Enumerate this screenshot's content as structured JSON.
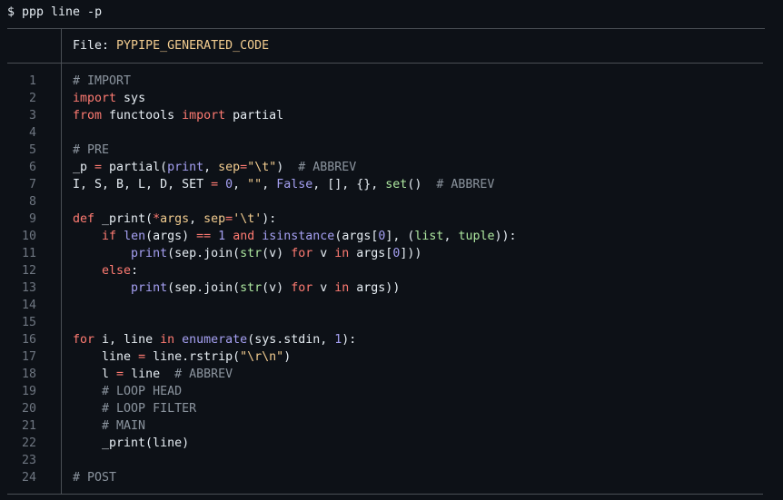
{
  "terminal": {
    "prompt": "$ ppp line -p",
    "header_label": "File: ",
    "header_filename": "PYPIPE_GENERATED_CODE"
  },
  "line_numbers": [
    "1",
    "2",
    "3",
    "4",
    "5",
    "6",
    "7",
    "8",
    "9",
    "10",
    "11",
    "12",
    "13",
    "14",
    "15",
    "16",
    "17",
    "18",
    "19",
    "20",
    "21",
    "22",
    "23",
    "24"
  ],
  "code_lines": [
    [
      {
        "t": "# IMPORT",
        "c": "cm"
      }
    ],
    [
      {
        "t": "import",
        "c": "kw"
      },
      {
        "t": " sys",
        "c": "plain"
      }
    ],
    [
      {
        "t": "from",
        "c": "kw"
      },
      {
        "t": " functools ",
        "c": "plain"
      },
      {
        "t": "import",
        "c": "kw"
      },
      {
        "t": " partial",
        "c": "plain"
      }
    ],
    [],
    [
      {
        "t": "# PRE",
        "c": "cm"
      }
    ],
    [
      {
        "t": "_p",
        "c": "plain"
      },
      {
        "t": " = ",
        "c": "op"
      },
      {
        "t": "partial(",
        "c": "plain"
      },
      {
        "t": "print",
        "c": "bi"
      },
      {
        "t": ", ",
        "c": "plain"
      },
      {
        "t": "sep",
        "c": "str"
      },
      {
        "t": "=",
        "c": "op"
      },
      {
        "t": "\"\\t\"",
        "c": "str"
      },
      {
        "t": ")  ",
        "c": "plain"
      },
      {
        "t": "# ABBREV",
        "c": "cm"
      }
    ],
    [
      {
        "t": "I, S, B, L, D, SET ",
        "c": "plain"
      },
      {
        "t": "=",
        "c": "op"
      },
      {
        "t": " ",
        "c": "plain"
      },
      {
        "t": "0",
        "c": "num"
      },
      {
        "t": ", ",
        "c": "plain"
      },
      {
        "t": "\"\"",
        "c": "str"
      },
      {
        "t": ", ",
        "c": "plain"
      },
      {
        "t": "False",
        "c": "bi"
      },
      {
        "t": ", [], {}, ",
        "c": "plain"
      },
      {
        "t": "set",
        "c": "green"
      },
      {
        "t": "()  ",
        "c": "plain"
      },
      {
        "t": "# ABBREV",
        "c": "cm"
      }
    ],
    [],
    [
      {
        "t": "def",
        "c": "kw"
      },
      {
        "t": " _print(",
        "c": "plain"
      },
      {
        "t": "*",
        "c": "op"
      },
      {
        "t": "args",
        "c": "str"
      },
      {
        "t": ", ",
        "c": "plain"
      },
      {
        "t": "sep",
        "c": "str"
      },
      {
        "t": "=",
        "c": "op"
      },
      {
        "t": "'\\t'",
        "c": "str"
      },
      {
        "t": "):",
        "c": "plain"
      }
    ],
    [
      {
        "t": "    ",
        "c": "plain"
      },
      {
        "t": "if",
        "c": "kw"
      },
      {
        "t": " ",
        "c": "plain"
      },
      {
        "t": "len",
        "c": "bi"
      },
      {
        "t": "(args) ",
        "c": "plain"
      },
      {
        "t": "==",
        "c": "op"
      },
      {
        "t": " ",
        "c": "plain"
      },
      {
        "t": "1",
        "c": "num"
      },
      {
        "t": " ",
        "c": "plain"
      },
      {
        "t": "and",
        "c": "kw"
      },
      {
        "t": " ",
        "c": "plain"
      },
      {
        "t": "isinstance",
        "c": "bi"
      },
      {
        "t": "(args[",
        "c": "plain"
      },
      {
        "t": "0",
        "c": "num"
      },
      {
        "t": "], (",
        "c": "plain"
      },
      {
        "t": "list",
        "c": "green"
      },
      {
        "t": ", ",
        "c": "plain"
      },
      {
        "t": "tuple",
        "c": "green"
      },
      {
        "t": ")):",
        "c": "plain"
      }
    ],
    [
      {
        "t": "        ",
        "c": "plain"
      },
      {
        "t": "print",
        "c": "bi"
      },
      {
        "t": "(sep.join(",
        "c": "plain"
      },
      {
        "t": "str",
        "c": "green"
      },
      {
        "t": "(v) ",
        "c": "plain"
      },
      {
        "t": "for",
        "c": "kw"
      },
      {
        "t": " v ",
        "c": "plain"
      },
      {
        "t": "in",
        "c": "kw"
      },
      {
        "t": " args[",
        "c": "plain"
      },
      {
        "t": "0",
        "c": "num"
      },
      {
        "t": "]))",
        "c": "plain"
      }
    ],
    [
      {
        "t": "    ",
        "c": "plain"
      },
      {
        "t": "else",
        "c": "kw"
      },
      {
        "t": ":",
        "c": "plain"
      }
    ],
    [
      {
        "t": "        ",
        "c": "plain"
      },
      {
        "t": "print",
        "c": "bi"
      },
      {
        "t": "(sep.join(",
        "c": "plain"
      },
      {
        "t": "str",
        "c": "green"
      },
      {
        "t": "(v) ",
        "c": "plain"
      },
      {
        "t": "for",
        "c": "kw"
      },
      {
        "t": " v ",
        "c": "plain"
      },
      {
        "t": "in",
        "c": "kw"
      },
      {
        "t": " args))",
        "c": "plain"
      }
    ],
    [],
    [],
    [
      {
        "t": "for",
        "c": "kw"
      },
      {
        "t": " i, line ",
        "c": "plain"
      },
      {
        "t": "in",
        "c": "kw"
      },
      {
        "t": " ",
        "c": "plain"
      },
      {
        "t": "enumerate",
        "c": "bi"
      },
      {
        "t": "(sys.stdin, ",
        "c": "plain"
      },
      {
        "t": "1",
        "c": "num"
      },
      {
        "t": "):",
        "c": "plain"
      }
    ],
    [
      {
        "t": "    line ",
        "c": "plain"
      },
      {
        "t": "=",
        "c": "op"
      },
      {
        "t": " line.rstrip(",
        "c": "plain"
      },
      {
        "t": "\"\\r\\n\"",
        "c": "str"
      },
      {
        "t": ")",
        "c": "plain"
      }
    ],
    [
      {
        "t": "    l ",
        "c": "plain"
      },
      {
        "t": "=",
        "c": "op"
      },
      {
        "t": " line  ",
        "c": "plain"
      },
      {
        "t": "# ABBREV",
        "c": "cm"
      }
    ],
    [
      {
        "t": "    ",
        "c": "plain"
      },
      {
        "t": "# LOOP HEAD",
        "c": "cm"
      }
    ],
    [
      {
        "t": "    ",
        "c": "plain"
      },
      {
        "t": "# LOOP FILTER",
        "c": "cm"
      }
    ],
    [
      {
        "t": "    ",
        "c": "plain"
      },
      {
        "t": "# MAIN",
        "c": "cm"
      }
    ],
    [
      {
        "t": "    _print(line)",
        "c": "plain"
      }
    ],
    [],
    [
      {
        "t": "# POST",
        "c": "cm"
      }
    ]
  ]
}
